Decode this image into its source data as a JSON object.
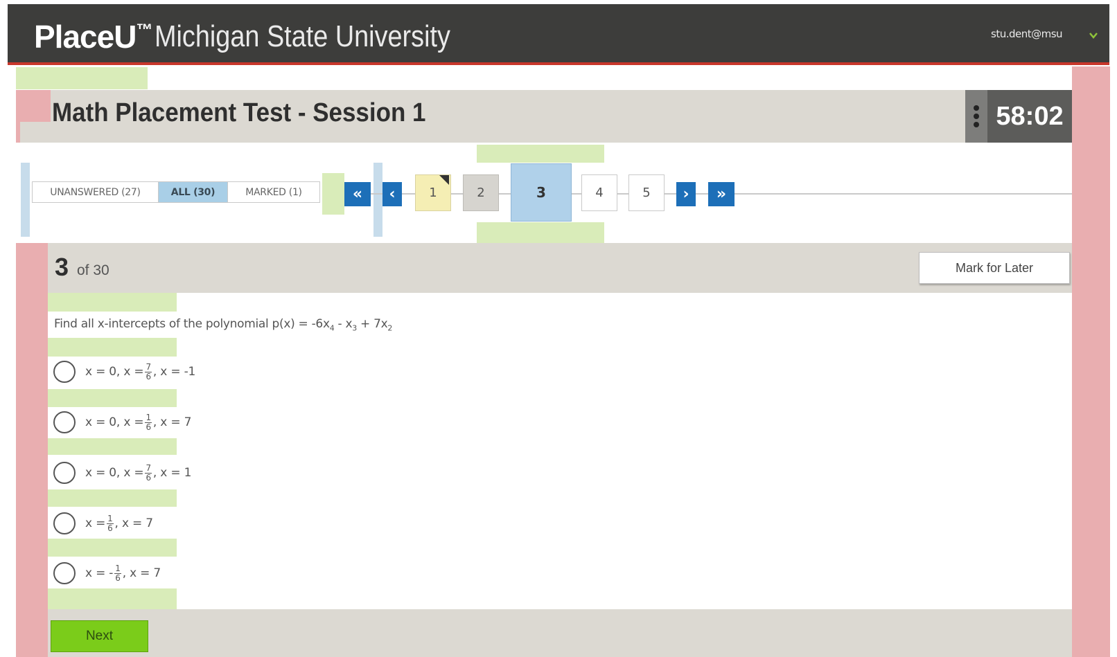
{
  "header": {
    "brand": "PlaceU",
    "brand_tm": "™",
    "university": "Michigan State University",
    "user": "stu.dent@msu"
  },
  "test": {
    "title": "Math Placement Test - Session 1",
    "timer": "58:02"
  },
  "filters": {
    "unanswered": "UNANSWERED (27)",
    "all": "ALL (30)",
    "marked": "MARKED (1)"
  },
  "nav": {
    "first": "«",
    "prev": "‹",
    "next": "›",
    "last": "»",
    "questions": [
      "1",
      "2",
      "3",
      "4",
      "5"
    ]
  },
  "question": {
    "number": "3",
    "of_total": "of 30",
    "mark_label": "Mark for Later",
    "prompt_text": "Find all x-intercepts of the polynomial p(x) = -6x",
    "prompt_sub1": "4",
    "prompt_mid": " - x",
    "prompt_sub2": "3",
    "prompt_mid2": " + 7x",
    "prompt_sub3": "2",
    "choices": [
      {
        "pre": "x = 0, x = ",
        "num": "7",
        "den": "6",
        "post": ", x = -1"
      },
      {
        "pre": "x = 0, x = ",
        "num": "1",
        "den": "6",
        "post": ", x = 7"
      },
      {
        "pre": "x = 0, x = ",
        "num": "7",
        "den": "6",
        "post": ", x = 1"
      },
      {
        "pre": "x = ",
        "num": "1",
        "den": "6",
        "post": ", x = 7"
      },
      {
        "pre": "x = -",
        "num": "1",
        "den": "6",
        "post": ", x = 7"
      }
    ]
  },
  "footer": {
    "next_label": "Next"
  },
  "colors": {
    "header_bg": "#3d3d3b",
    "accent_red": "#c8372b",
    "nav_blue": "#1d6fb8",
    "next_green": "#7bcc1a"
  }
}
